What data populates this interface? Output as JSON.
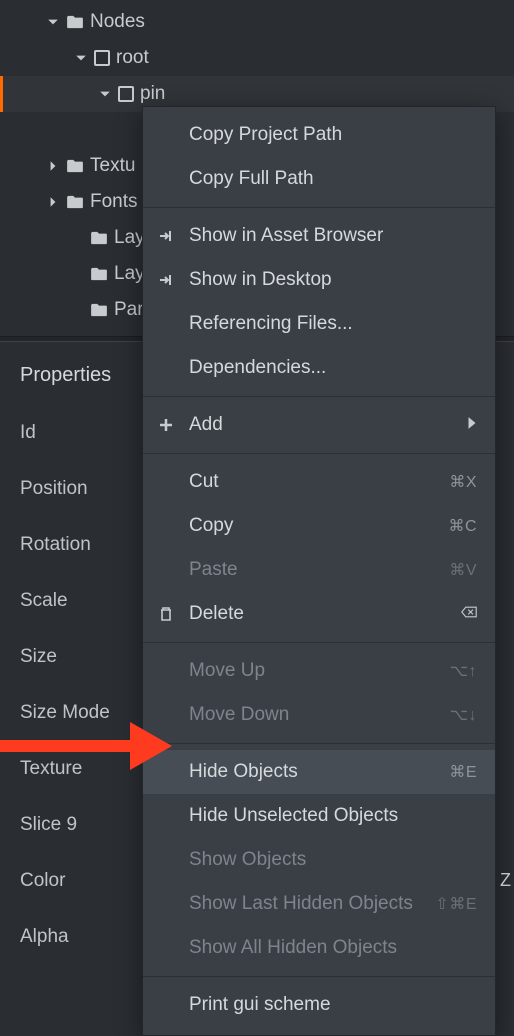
{
  "tree": {
    "items": [
      {
        "indent": 32,
        "expander": "down",
        "icon": "folder",
        "label": "Nodes",
        "selected": false
      },
      {
        "indent": 60,
        "expander": "down",
        "icon": "box",
        "label": "root",
        "selected": false
      },
      {
        "indent": 84,
        "expander": "down",
        "icon": "box",
        "label": "pin",
        "selected": true
      },
      {
        "indent": 124,
        "expander": "none",
        "icon": "box",
        "label": "",
        "selected": false
      },
      {
        "indent": 32,
        "expander": "right",
        "icon": "folder",
        "label": "Textu",
        "selected": false
      },
      {
        "indent": 32,
        "expander": "right",
        "icon": "folder",
        "label": "Fonts",
        "selected": false
      },
      {
        "indent": 56,
        "expander": "none",
        "icon": "folder",
        "label": "Laye",
        "selected": false
      },
      {
        "indent": 56,
        "expander": "none",
        "icon": "folder",
        "label": "Layo",
        "selected": false
      },
      {
        "indent": 56,
        "expander": "none",
        "icon": "folder",
        "label": "Parti",
        "selected": false
      }
    ]
  },
  "properties": {
    "header": "Properties",
    "rows": [
      "Id",
      "Position",
      "Rotation",
      "Scale",
      "Size",
      "Size Mode",
      "Texture",
      "Slice 9",
      "Color",
      "Alpha"
    ]
  },
  "context_menu": {
    "groups": [
      [
        {
          "icon": "",
          "label": "Copy Project Path",
          "shortcut": "",
          "disabled": false
        },
        {
          "icon": "",
          "label": "Copy Full Path",
          "shortcut": "",
          "disabled": false
        }
      ],
      [
        {
          "icon": "goto",
          "label": "Show in Asset Browser",
          "shortcut": "",
          "disabled": false
        },
        {
          "icon": "goto",
          "label": "Show in Desktop",
          "shortcut": "",
          "disabled": false
        },
        {
          "icon": "",
          "label": "Referencing Files...",
          "shortcut": "",
          "disabled": false
        },
        {
          "icon": "",
          "label": "Dependencies...",
          "shortcut": "",
          "disabled": false
        }
      ],
      [
        {
          "icon": "plus",
          "label": "Add",
          "shortcut": "",
          "disabled": false,
          "submenu": true
        }
      ],
      [
        {
          "icon": "",
          "label": "Cut",
          "shortcut": "⌘X",
          "disabled": false
        },
        {
          "icon": "",
          "label": "Copy",
          "shortcut": "⌘C",
          "disabled": false
        },
        {
          "icon": "",
          "label": "Paste",
          "shortcut": "⌘V",
          "disabled": true
        },
        {
          "icon": "trash",
          "label": "Delete",
          "shortcut": "⌫",
          "disabled": false
        }
      ],
      [
        {
          "icon": "",
          "label": "Move Up",
          "shortcut": "⌥↑",
          "disabled": true
        },
        {
          "icon": "",
          "label": "Move Down",
          "shortcut": "⌥↓",
          "disabled": true
        }
      ],
      [
        {
          "icon": "",
          "label": "Hide Objects",
          "shortcut": "⌘E",
          "disabled": false,
          "hover": true
        },
        {
          "icon": "",
          "label": "Hide Unselected Objects",
          "shortcut": "",
          "disabled": false
        },
        {
          "icon": "",
          "label": "Show Objects",
          "shortcut": "",
          "disabled": true
        },
        {
          "icon": "",
          "label": "Show Last Hidden Objects",
          "shortcut": "⇧⌘E",
          "disabled": true
        },
        {
          "icon": "",
          "label": "Show All Hidden Objects",
          "shortcut": "",
          "disabled": true
        }
      ],
      [
        {
          "icon": "",
          "label": "Print gui scheme",
          "shortcut": "",
          "disabled": false
        }
      ]
    ]
  },
  "visible_text_behind_menu": {
    "row8_trailing": "Z"
  }
}
